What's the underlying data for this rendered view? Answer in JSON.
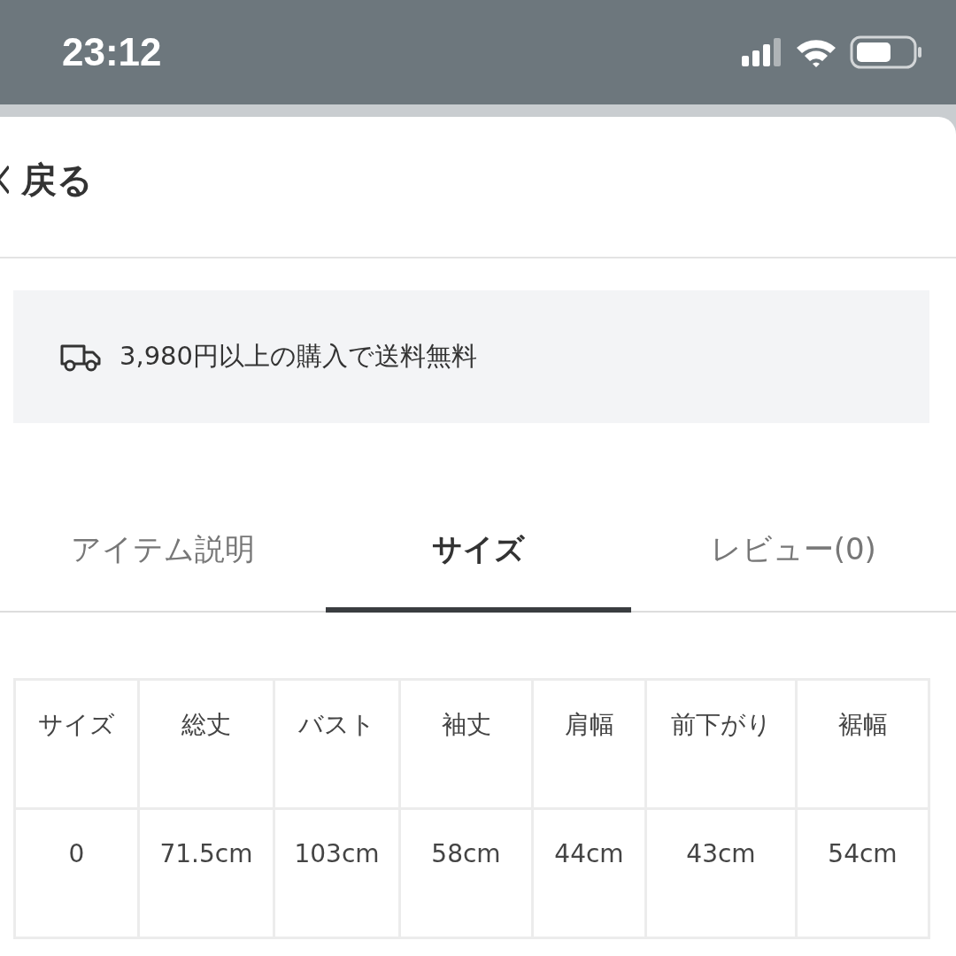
{
  "status_bar": {
    "time": "23:12"
  },
  "header": {
    "back_label": "戻る"
  },
  "banner": {
    "text": "3,980円以上の購入で送料無料"
  },
  "tabs": [
    {
      "label": "アイテム説明",
      "selected": false
    },
    {
      "label": "サイズ",
      "selected": true
    },
    {
      "label": "レビュー(0)",
      "selected": false
    }
  ],
  "size_table": {
    "columns": [
      "サイズ",
      "総丈",
      "バスト",
      "袖丈",
      "肩幅",
      "前下がり",
      "裾幅"
    ],
    "rows": [
      [
        "0",
        "71.5cm",
        "103cm",
        "58cm",
        "44cm",
        "43cm",
        "54cm"
      ]
    ]
  }
}
